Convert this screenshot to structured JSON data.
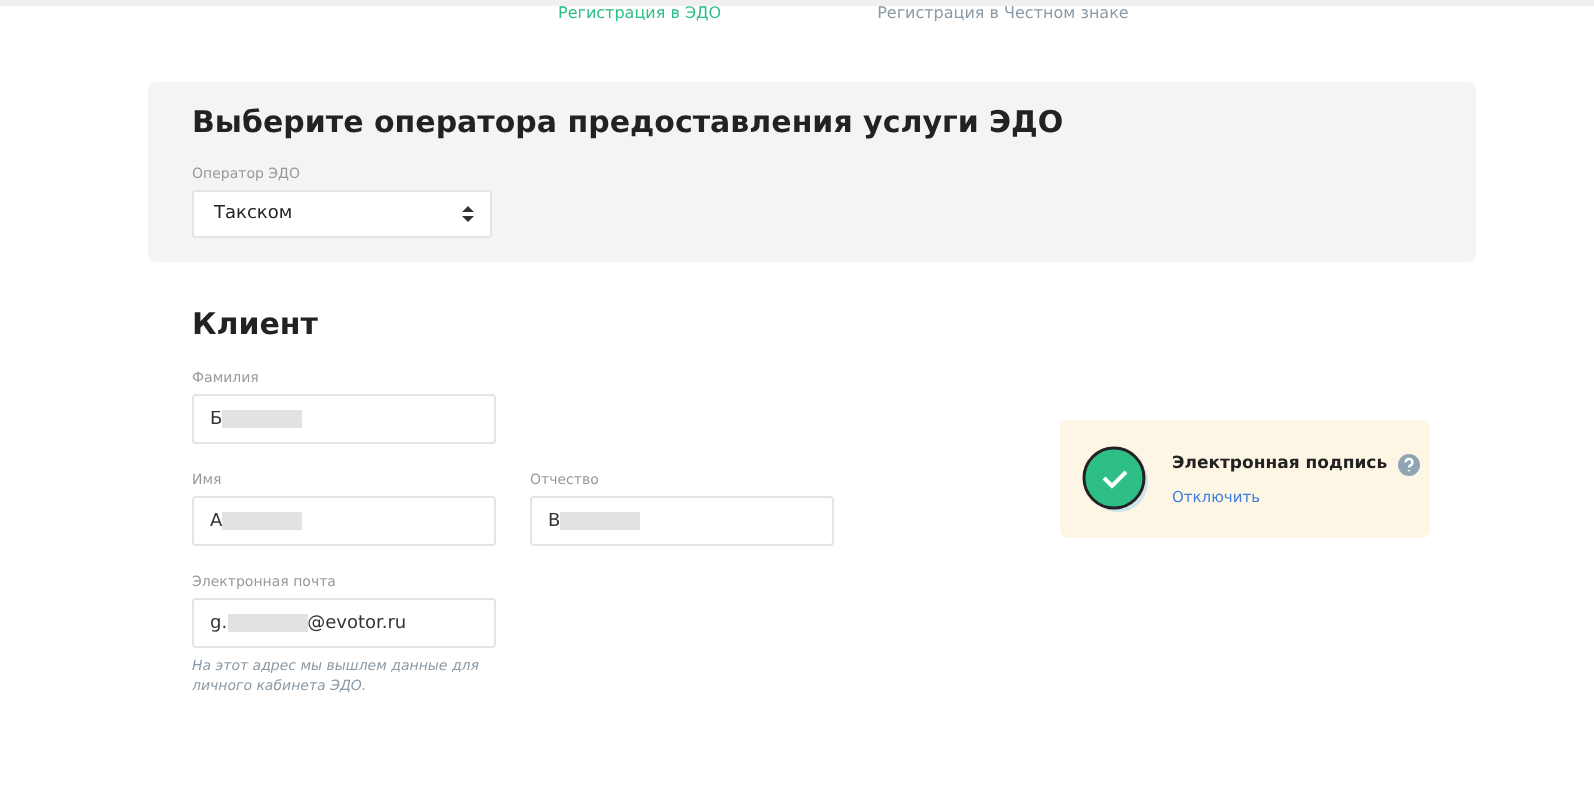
{
  "tabs": [
    {
      "label": "Регистрация в ЭДО",
      "selected": true
    },
    {
      "label": "Регистрация в Честном знаке",
      "selected": false
    }
  ],
  "operator_section": {
    "title": "Выберите оператора предоставления услуги ЭДО",
    "field": {
      "label": "Оператор ЭДО",
      "value": "Такском"
    }
  },
  "client": {
    "title": "Клиент",
    "fields": [
      {
        "label": "Фамилия",
        "value": "Б",
        "redacted": true
      },
      {
        "label": "Имя",
        "value": "А",
        "redacted": true
      },
      {
        "label": "Отчество",
        "value": "В",
        "redacted": true
      },
      {
        "label": "Электронная почта",
        "value": "g.",
        "value_end": "@evotor.ru",
        "redacted": true
      }
    ],
    "hint": "На этот адрес мы вышлем данные для личного кабинета ЭДО."
  },
  "signature": {
    "title": "Электронная подпись",
    "action": "Отключить",
    "enabled": true
  }
}
